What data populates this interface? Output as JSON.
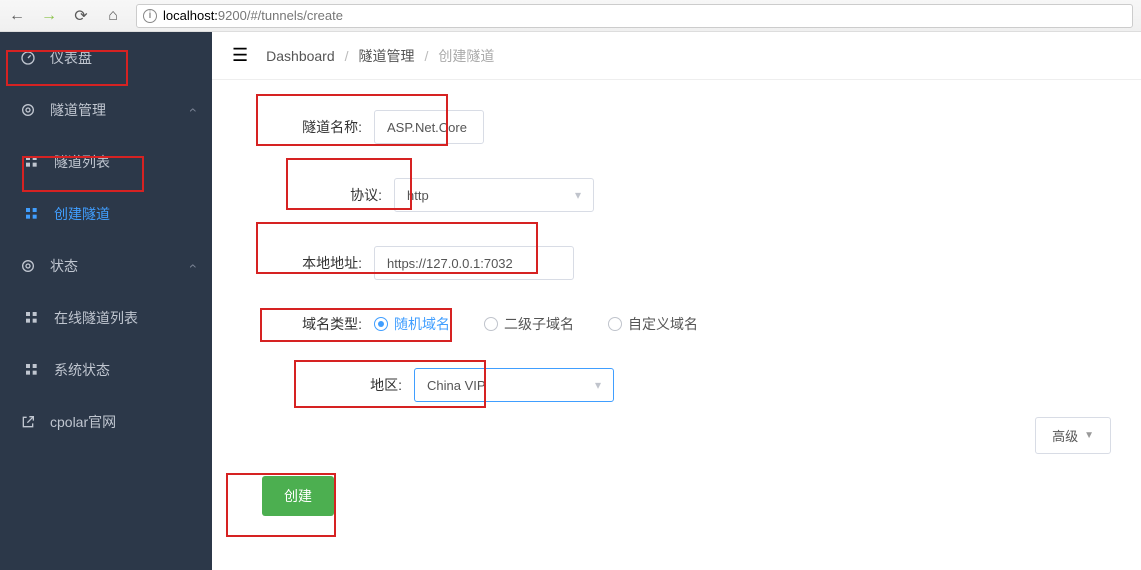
{
  "browser": {
    "url_host": "localhost:",
    "url_port": "9200",
    "url_path": "/#/tunnels/create"
  },
  "sidebar": {
    "items": [
      {
        "label": "仪表盘"
      },
      {
        "label": "隧道管理"
      },
      {
        "label": "隧道列表"
      },
      {
        "label": "创建隧道"
      },
      {
        "label": "状态"
      },
      {
        "label": "在线隧道列表"
      },
      {
        "label": "系统状态"
      },
      {
        "label": "cpolar官网"
      }
    ]
  },
  "breadcrumb": {
    "a": "Dashboard",
    "b": "隧道管理",
    "c": "创建隧道"
  },
  "form": {
    "tunnel_name_label": "隧道名称:",
    "tunnel_name_value": "ASP.Net.Core",
    "protocol_label": "协议:",
    "protocol_value": "http",
    "local_addr_label": "本地地址:",
    "local_addr_value": "https://127.0.0.1:7032",
    "domain_type_label": "域名类型:",
    "domain_opts": {
      "random": "随机域名",
      "sub": "二级子域名",
      "custom": "自定义域名"
    },
    "region_label": "地区:",
    "region_value": "China VIP",
    "create_btn": "创建",
    "advanced_btn": "高级"
  }
}
